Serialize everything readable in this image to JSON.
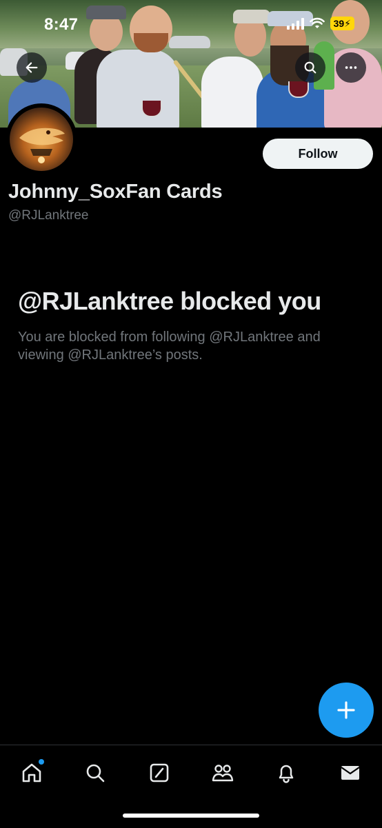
{
  "status_bar": {
    "time": "8:47",
    "battery": "39",
    "battery_color": "#ffd60a"
  },
  "header": {
    "back_icon": "arrow-left-icon",
    "search_icon": "search-icon",
    "more_icon": "more-horizontal-icon"
  },
  "profile": {
    "display_name": "Johnny_SoxFan Cards",
    "handle": "@RJLanktree",
    "follow_label": "Follow"
  },
  "blocked": {
    "title": "@RJLanktree blocked you",
    "body": "You are blocked from following @RJLanktree and viewing @RJLanktree’s posts."
  },
  "fab": {
    "icon": "plus-icon",
    "color": "#1d9bf0"
  },
  "bottom_nav": {
    "items": [
      {
        "icon": "home-icon",
        "has_notification_dot": true
      },
      {
        "icon": "search-icon"
      },
      {
        "icon": "grok-icon"
      },
      {
        "icon": "communities-icon"
      },
      {
        "icon": "notifications-bell-icon"
      },
      {
        "icon": "messages-envelope-icon"
      }
    ]
  },
  "colors": {
    "background": "#000000",
    "primary_text": "#e7e9ea",
    "secondary_text": "#71767b",
    "accent": "#1d9bf0"
  }
}
